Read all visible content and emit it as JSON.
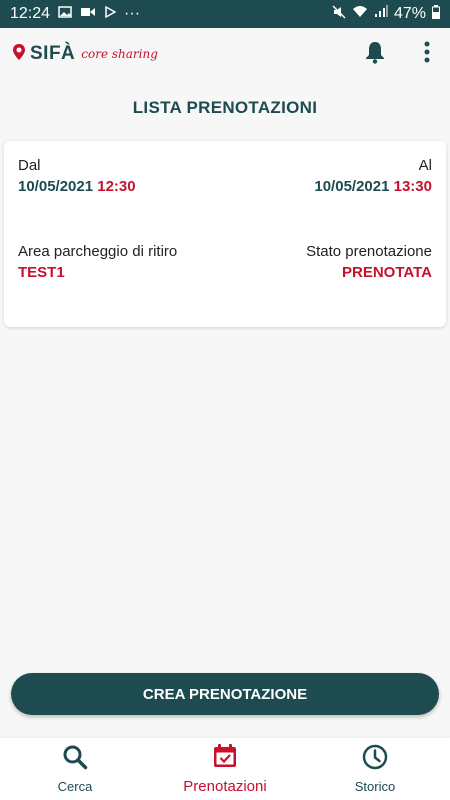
{
  "status_bar": {
    "time": "12:24",
    "more": "···",
    "battery": "47%"
  },
  "app_bar": {
    "logo_text": "SIFÀ",
    "logo_subtitle": "core sharing",
    "icons": [
      "location-pin-icon",
      "bell-icon",
      "more-vert-icon"
    ]
  },
  "page": {
    "title": "LISTA PRENOTAZIONI"
  },
  "reservations": [
    {
      "from_label": "Dal",
      "from_date": "10/05/2021",
      "from_time": "12:30",
      "to_label": "Al",
      "to_date": "10/05/2021",
      "to_time": "13:30",
      "area_label": "Area parcheggio di ritiro",
      "area_value": "TEST1",
      "status_label": "Stato prenotazione",
      "status_value": "PRENOTATA"
    }
  ],
  "cta": {
    "label": "CREA PRENOTAZIONE"
  },
  "bottom_nav": [
    {
      "label": "Cerca",
      "icon": "search-icon",
      "active": false
    },
    {
      "label": "Prenotazioni",
      "icon": "calendar-check-icon",
      "active": true
    },
    {
      "label": "Storico",
      "icon": "clock-icon",
      "active": false
    }
  ],
  "colors": {
    "primary": "#1d4b50",
    "accent": "#c8102e",
    "background": "#f7f7f7"
  }
}
